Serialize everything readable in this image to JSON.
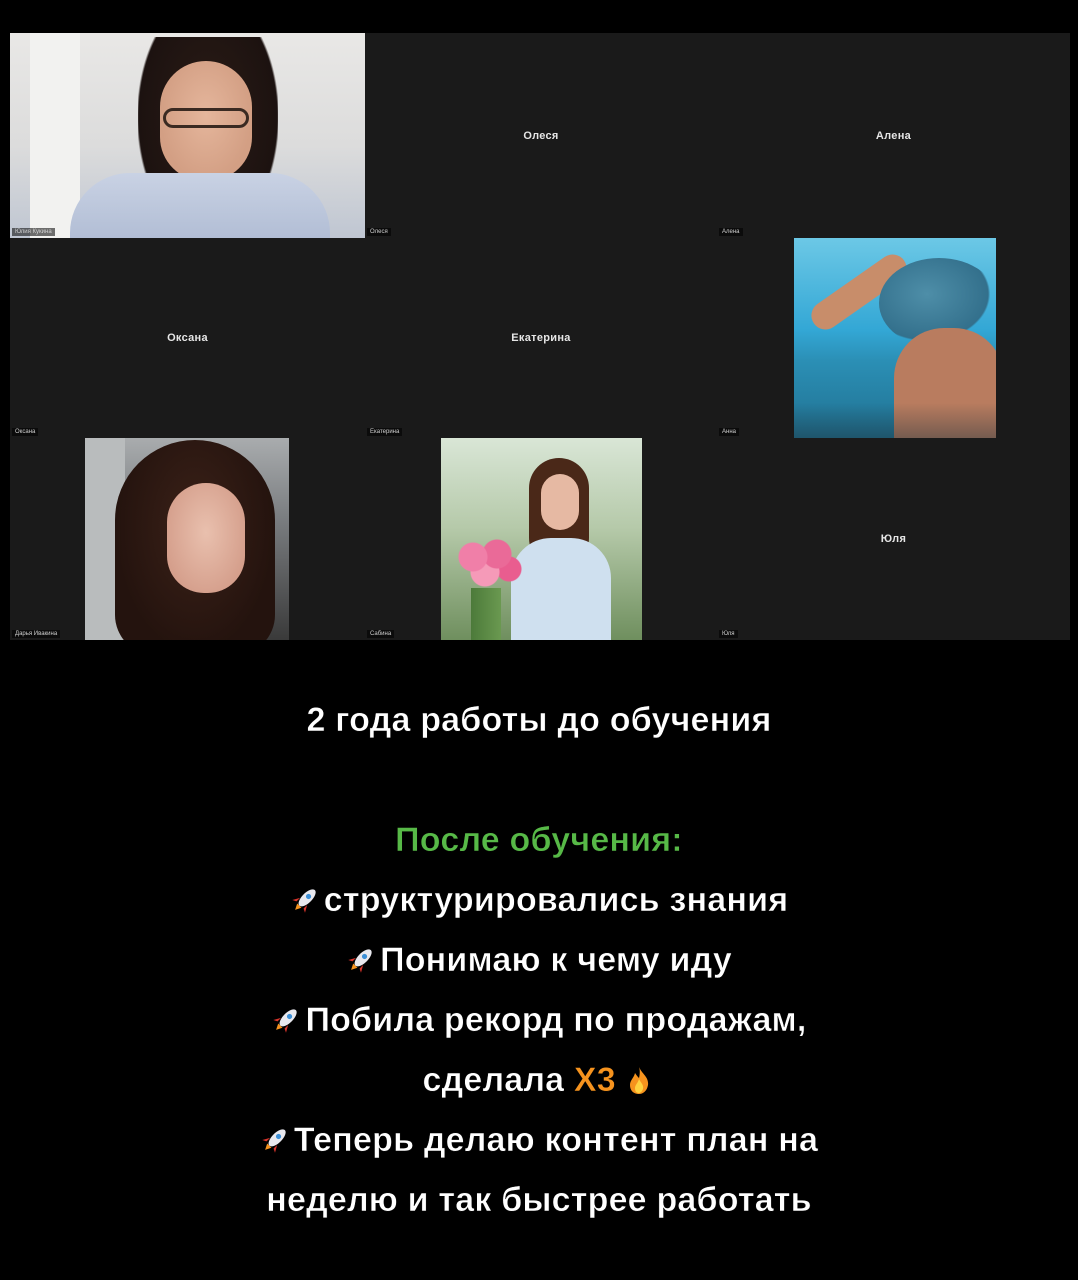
{
  "video_call": {
    "participants": [
      {
        "name": "Олеся",
        "tag": "Олеся"
      },
      {
        "name": "Алена",
        "tag": "Алена"
      },
      {
        "name": "Оксана",
        "tag": "Оксана"
      },
      {
        "name": "Екатерина",
        "tag": "Екатерина"
      },
      {
        "name": "Юля",
        "tag": "Юля"
      }
    ],
    "video_tags": [
      "Юлия Кукина",
      "Анна",
      "Дарья Ивакина",
      "Сабина"
    ]
  },
  "caption": {
    "headline": "2 года работы до обучения",
    "subheading": "После обучения:",
    "items": [
      "структурировались знания",
      "Понимаю к чему иду",
      "Побила рекорд по продажам,"
    ],
    "continuation_prefix": "сделала ",
    "continuation_highlight": "Х3",
    "last_item_line1": "Теперь делаю контент план на",
    "last_item_line2": "неделю и так быстрее работать"
  },
  "colors": {
    "background": "#000000",
    "grid_background": "#1a1a1a",
    "accent_green": "#57b947",
    "accent_orange": "#f6931e",
    "text": "#ffffff"
  },
  "icons": [
    "rocket-icon",
    "fire-icon"
  ]
}
